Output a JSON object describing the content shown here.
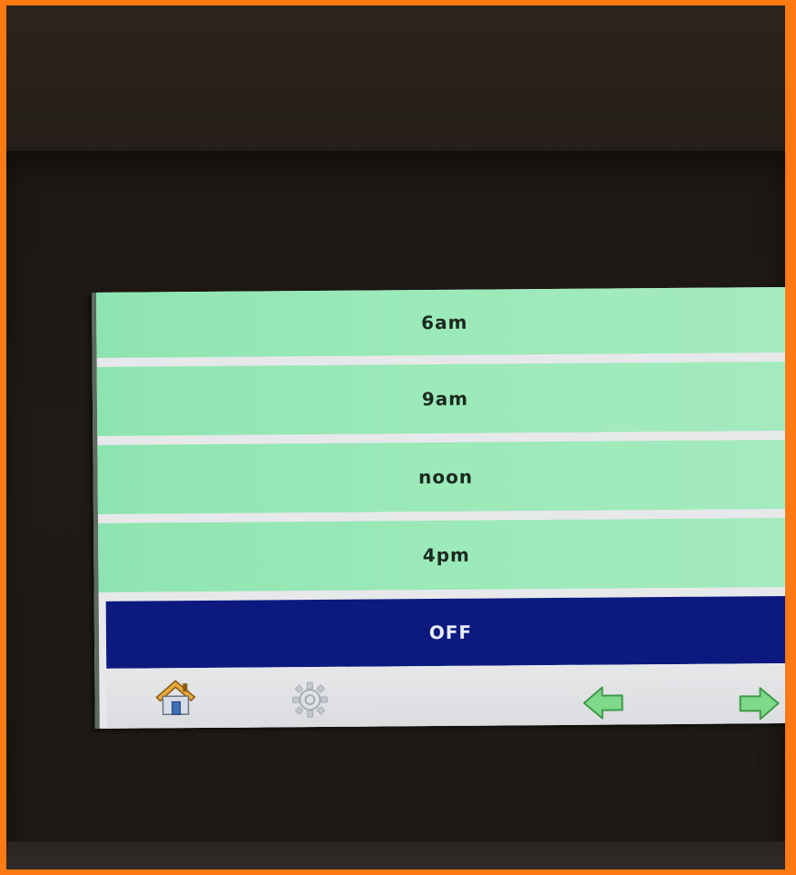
{
  "schedule": {
    "options": [
      {
        "label": "6am",
        "selected": false
      },
      {
        "label": "9am",
        "selected": false
      },
      {
        "label": "noon",
        "selected": false
      },
      {
        "label": "4pm",
        "selected": false
      },
      {
        "label": "OFF",
        "selected": true
      }
    ]
  },
  "toolbar": {
    "home_icon": "home-icon",
    "settings_icon": "gear-icon",
    "back_icon": "arrow-left-icon",
    "forward_icon": "arrow-right-icon"
  },
  "colors": {
    "frame": "#ff7a12",
    "row_green": "#9be9b9",
    "selected_row": "#0c1a80",
    "toolbar": "#e2e3e6",
    "arrow_green": "#6fd07a"
  }
}
